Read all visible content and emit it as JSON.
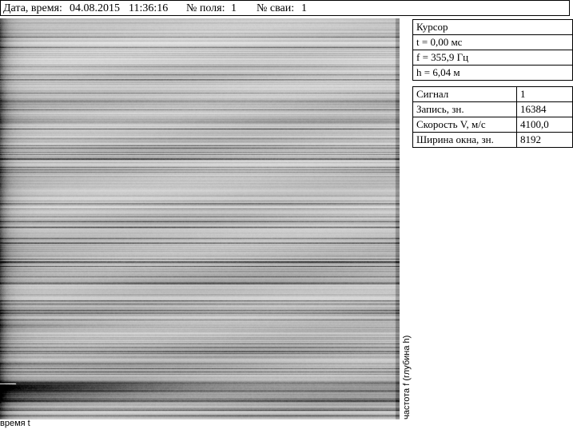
{
  "header": {
    "date_label": "Дата, время:",
    "date_value": "04.08.2015",
    "time_value": "11:36:16",
    "field_label": "№ поля:",
    "field_value": "1",
    "pile_label": "№ сваи:",
    "pile_value": "1"
  },
  "cursor": {
    "title": "Курсор",
    "t": "t = 0,00 мс",
    "f": "f = 355,9 Гц",
    "h": "h = 6,04 м"
  },
  "params": [
    {
      "label": "Сигнал",
      "value": "1"
    },
    {
      "label": "Запись, зн.",
      "value": "16384"
    },
    {
      "label": "Скорость V, м/с",
      "value": "4100,0"
    },
    {
      "label": "Ширина окна, зн.",
      "value": "8192"
    }
  ],
  "plot": {
    "xlabel": "время t",
    "ylabel": "частота f (глубина h)"
  }
}
